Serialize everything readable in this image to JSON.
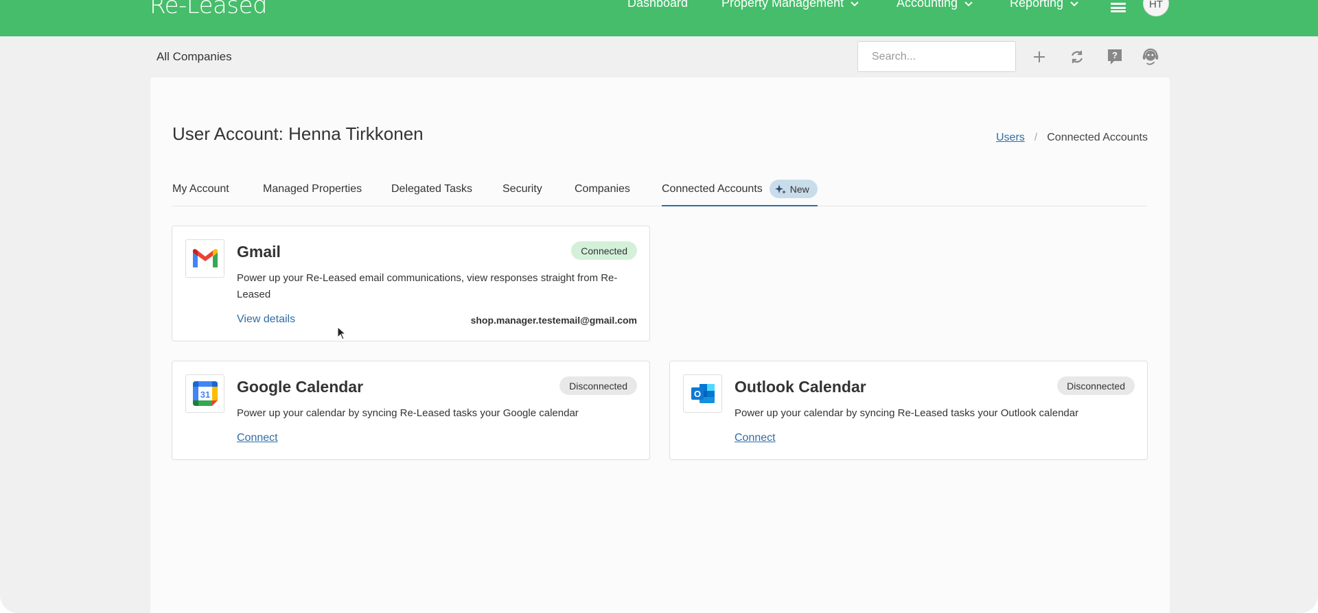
{
  "topnav": {
    "logo": "Re-Leased",
    "items": [
      {
        "label": "Dashboard"
      },
      {
        "label": "Property Management"
      },
      {
        "label": "Accounting"
      },
      {
        "label": "Reporting"
      }
    ],
    "avatar_initials": "HT",
    "brand_color": "#45bd6a"
  },
  "subheader": {
    "title": "All Companies",
    "search_placeholder": "Search..."
  },
  "page": {
    "title": "User Account: Henna Tirkkonen",
    "breadcrumb": {
      "link": "Users",
      "separator": "/",
      "current": "Connected Accounts"
    }
  },
  "tabs": [
    {
      "label": "My Account"
    },
    {
      "label": "Managed Properties"
    },
    {
      "label": "Delegated Tasks"
    },
    {
      "label": "Security"
    },
    {
      "label": "Companies"
    },
    {
      "label": "Connected Accounts",
      "active": true,
      "badge": "New"
    }
  ],
  "accounts": {
    "gmail": {
      "title": "Gmail",
      "status": "Connected",
      "description": "Power up your Re-Leased email communications, view responses straight from Re-Leased",
      "link": "View details",
      "email": "shop.manager.testemail@gmail.com",
      "icon": "gmail-icon"
    },
    "google_calendar": {
      "title": "Google Calendar",
      "status": "Disconnected",
      "description": "Power up your calendar by syncing Re-Leased tasks your Google calendar",
      "link": "Connect",
      "icon_text": "31",
      "icon": "google-calendar-icon"
    },
    "outlook_calendar": {
      "title": "Outlook Calendar",
      "status": "Disconnected",
      "description": "Power up your calendar by syncing Re-Leased tasks your Outlook calendar",
      "link": "Connect",
      "icon_text": "O",
      "icon": "outlook-icon"
    }
  }
}
